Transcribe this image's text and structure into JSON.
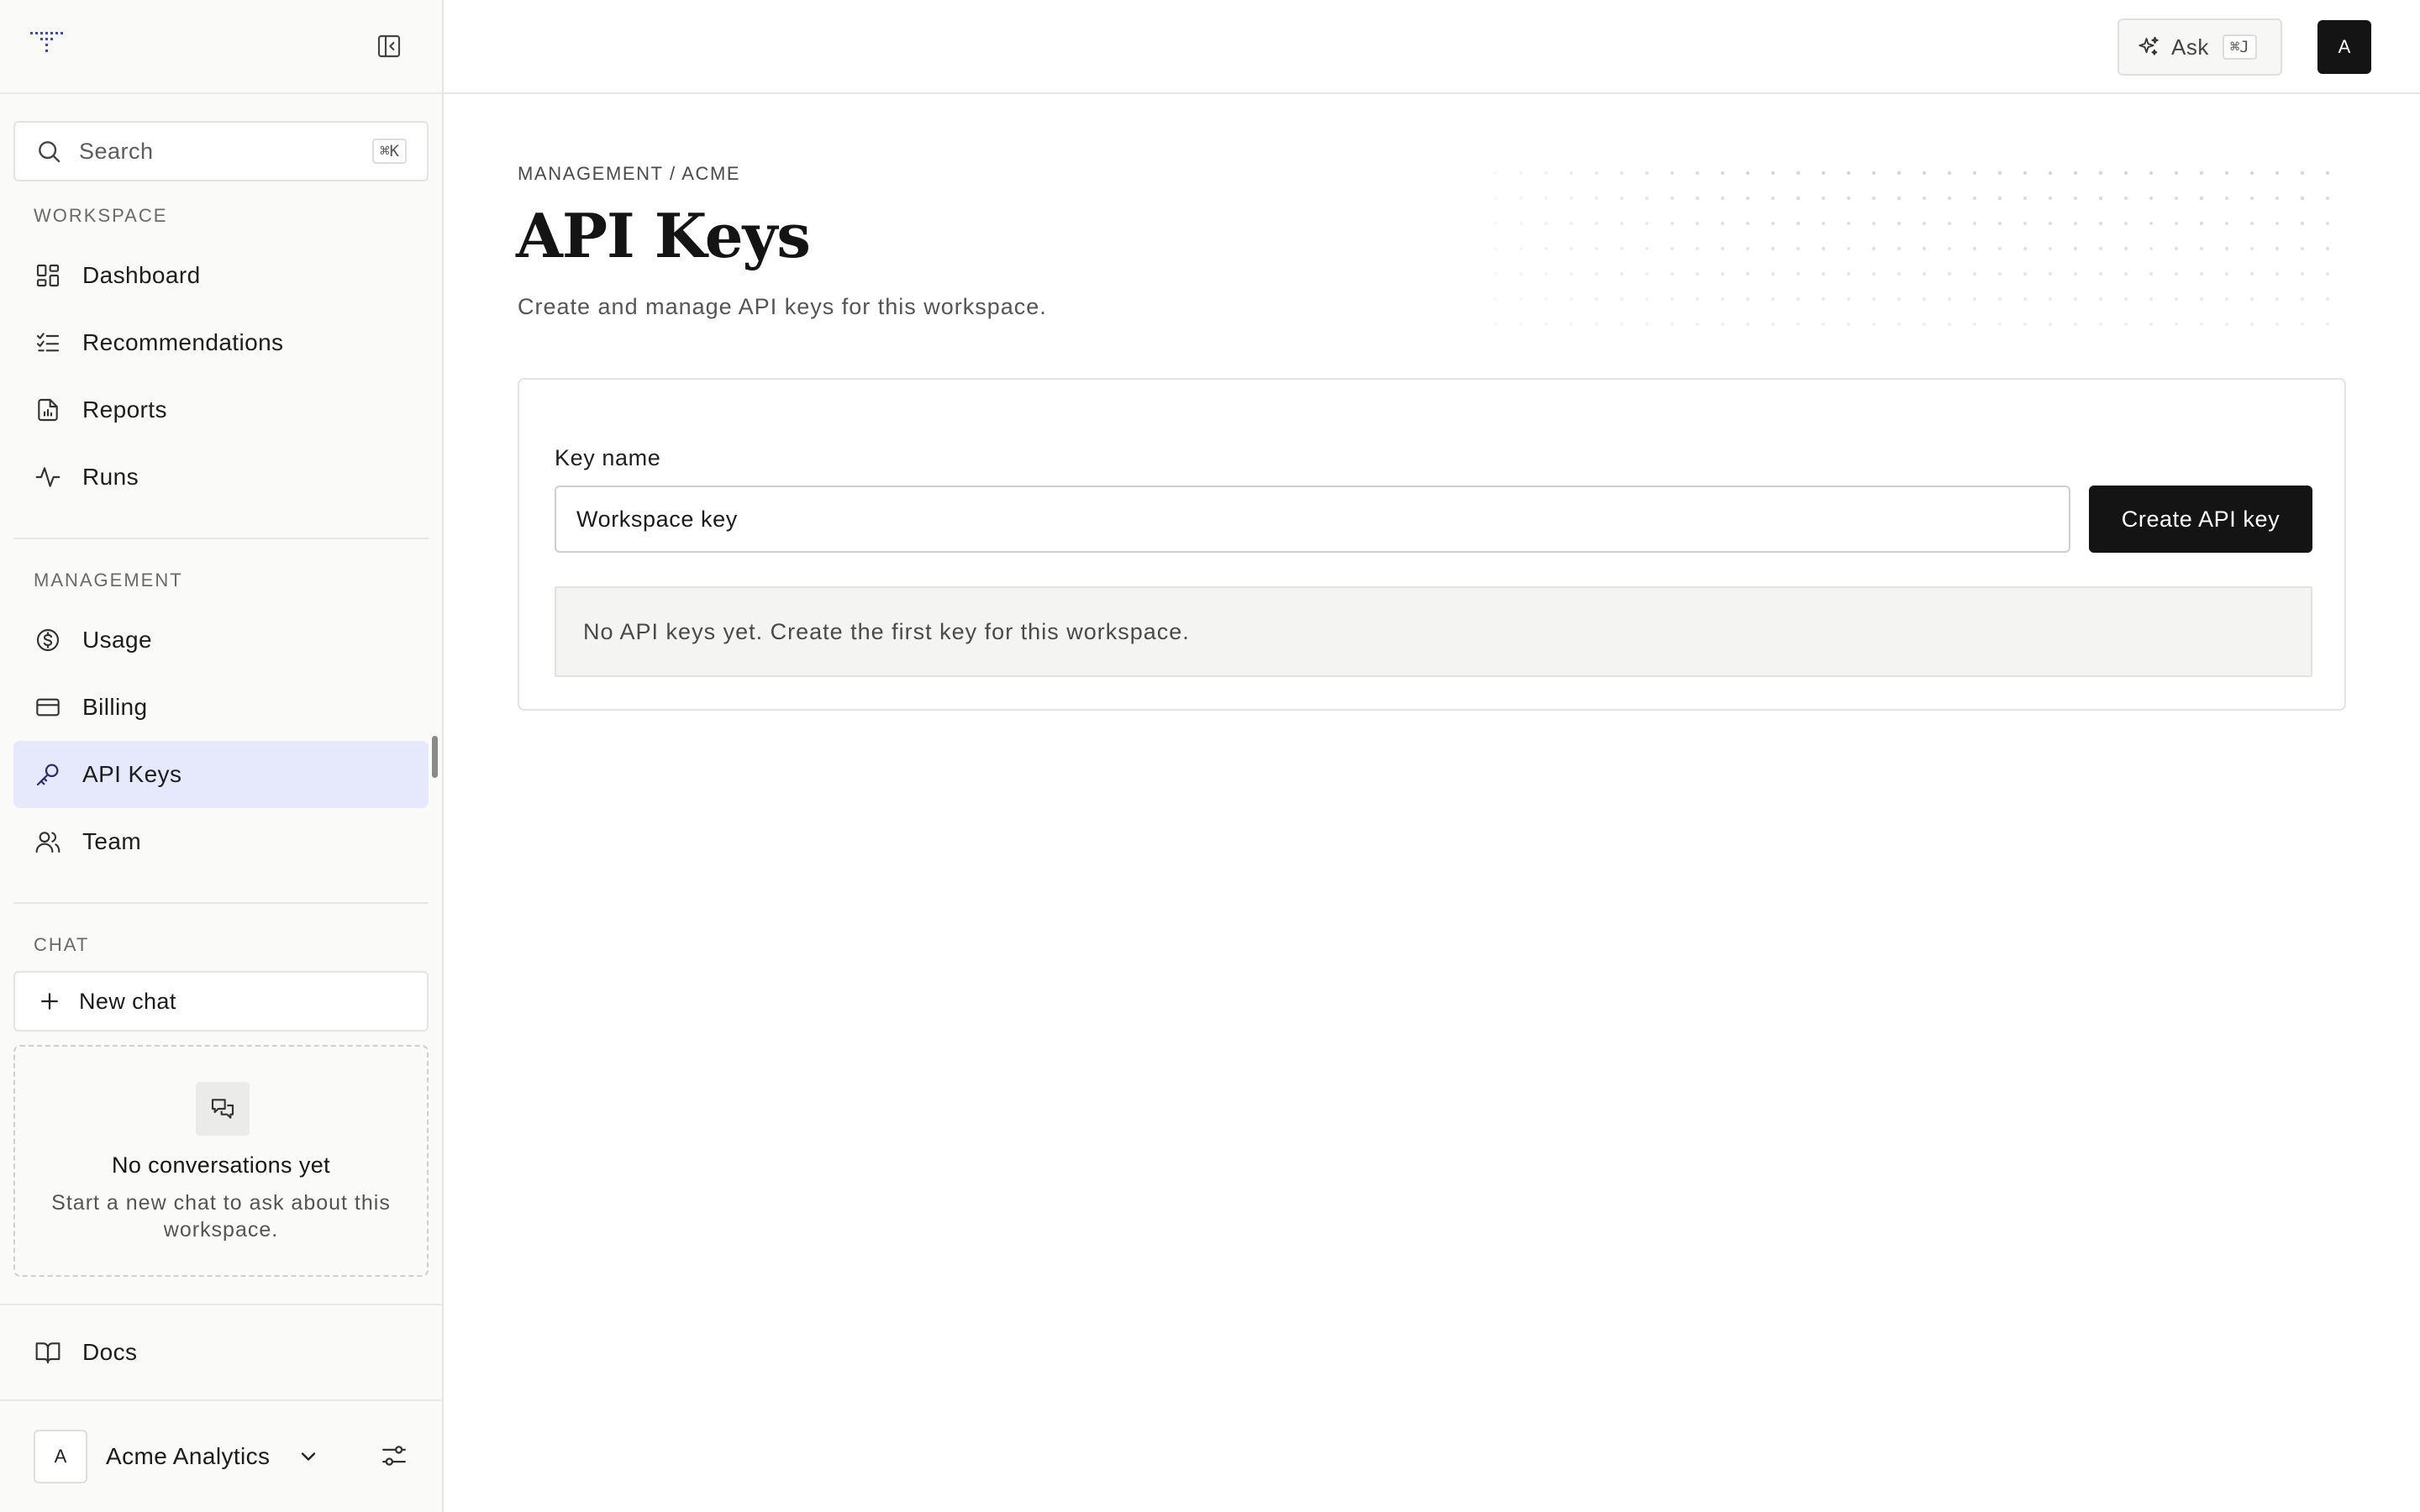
{
  "sidebar": {
    "search": {
      "label": "Search",
      "shortcut": "⌘K"
    },
    "workspace_label": "WORKSPACE",
    "workspace_items": [
      {
        "label": "Dashboard",
        "icon": "grid-icon"
      },
      {
        "label": "Recommendations",
        "icon": "checklist-icon"
      },
      {
        "label": "Reports",
        "icon": "file-chart-icon"
      },
      {
        "label": "Runs",
        "icon": "activity-icon"
      }
    ],
    "management_label": "MANAGEMENT",
    "management_items": [
      {
        "label": "Usage",
        "icon": "dollar-circle-icon"
      },
      {
        "label": "Billing",
        "icon": "credit-card-icon"
      },
      {
        "label": "API Keys",
        "icon": "key-icon",
        "active": true
      },
      {
        "label": "Team",
        "icon": "users-icon"
      }
    ],
    "chat_label": "CHAT",
    "new_chat_label": "New chat",
    "empty_chat": {
      "title": "No conversations yet",
      "description": "Start a new chat to ask about this workspace."
    },
    "docs_label": "Docs",
    "workspace_switcher": {
      "avatar_letter": "A",
      "name": "Acme Analytics"
    }
  },
  "topbar": {
    "ask_label": "Ask",
    "ask_shortcut": "⌘J",
    "user_avatar_letter": "A"
  },
  "main": {
    "breadcrumb": "MANAGEMENT / ACME",
    "title": "API Keys",
    "subtitle": "Create and manage API keys for this workspace.",
    "form": {
      "field_label": "Key name",
      "field_value": "Workspace key",
      "create_button": "Create API key"
    },
    "empty_state": "No API keys yet. Create the first key for this workspace."
  },
  "colors": {
    "accent_active_bg": "#e6e8fb",
    "primary_button": "#141414",
    "logo_blue": "#3b4cc0"
  }
}
